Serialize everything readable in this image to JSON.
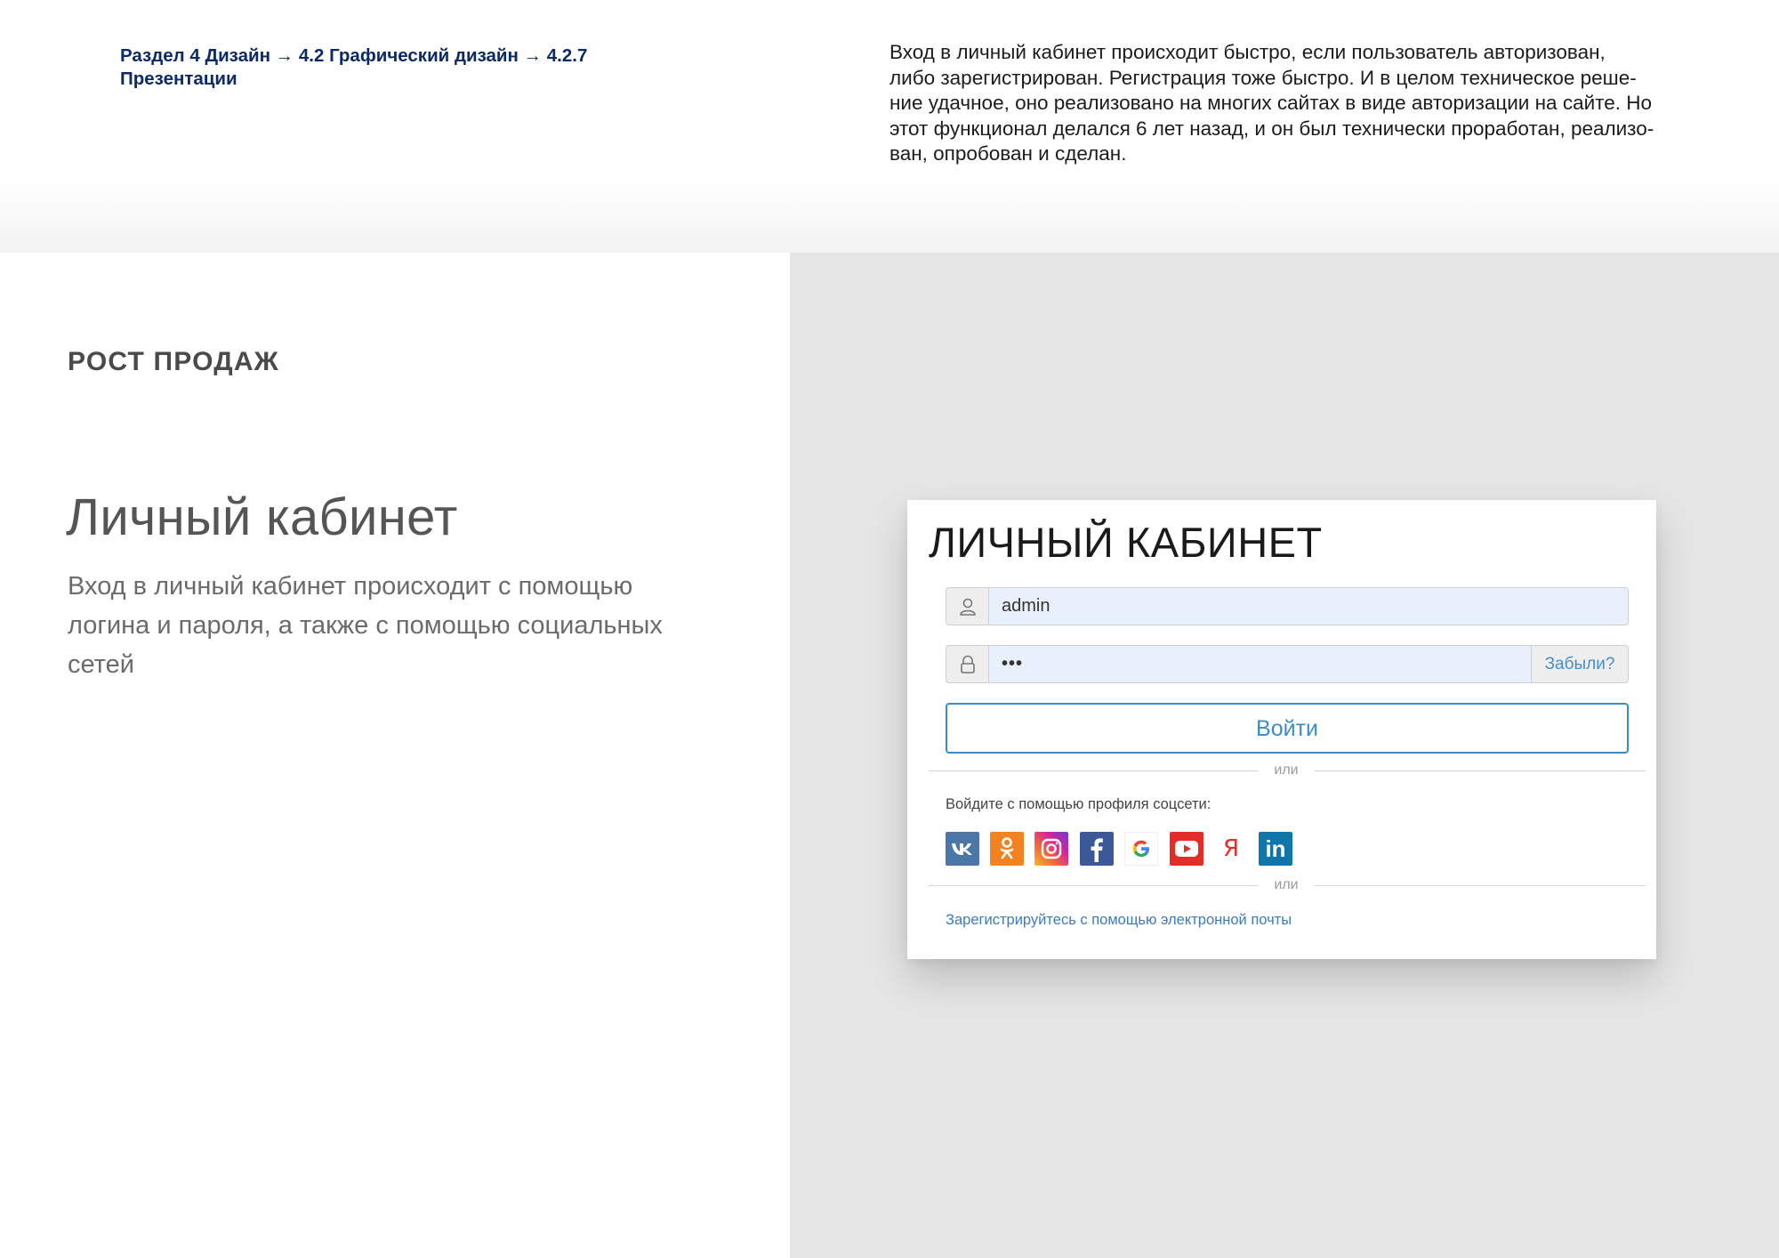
{
  "breadcrumb": {
    "line1": "Раздел 4 Дизайн  → 4.2 Графический дизайн → 4.2.7",
    "line2": "Презентации"
  },
  "intro_lines": [
    "Вход в личный кабинет происходит быстро, если пользователь авторизован,",
    "либо зарегистрирован. Регистрация тоже быстро. И в целом техническое реше-",
    "ние удачное, оно реализовано на многих сайтах в виде авторизации на сайте. Но",
    "этот функционал делался 6 лет назад, и он был технически проработан, реализо-",
    "ван, опробован и сделан."
  ],
  "section_label": "РОСТ ПРОДАЖ",
  "feature": {
    "title": "Личный кабинет",
    "desc_lines": [
      "Вход в личный кабинет происходит с помощью",
      "логина и пароля, а также с помощью социальных",
      "сетей"
    ]
  },
  "login": {
    "title": "ЛИЧНЫЙ КАБИНЕТ",
    "username_value": "admin",
    "password_value": "•••",
    "forgot_label": "Забыли?",
    "submit_label": "Войти",
    "or_label": "или",
    "social_label": "Войдите с помощью профиля соцсети:",
    "social_networks": [
      {
        "name": "vk-icon",
        "glyph": "vk",
        "color": "#4a76a8"
      },
      {
        "name": "odnoklassniki-icon",
        "glyph": "ok",
        "color": "#f58220"
      },
      {
        "name": "instagram-icon",
        "glyph": "ig",
        "color": "#d6249f"
      },
      {
        "name": "facebook-icon",
        "glyph": "f",
        "color": "#3b5998"
      },
      {
        "name": "google-icon",
        "glyph": "G",
        "color": "#ffffff"
      },
      {
        "name": "youtube-icon",
        "glyph": "yt",
        "color": "#e52d27"
      },
      {
        "name": "yandex-icon",
        "glyph": "Я",
        "color": "#ffffff"
      },
      {
        "name": "linkedin-icon",
        "glyph": "in",
        "color": "#0e76a8"
      }
    ],
    "register_label": "Зарегистрируйтесь с помощью электронной почты"
  }
}
